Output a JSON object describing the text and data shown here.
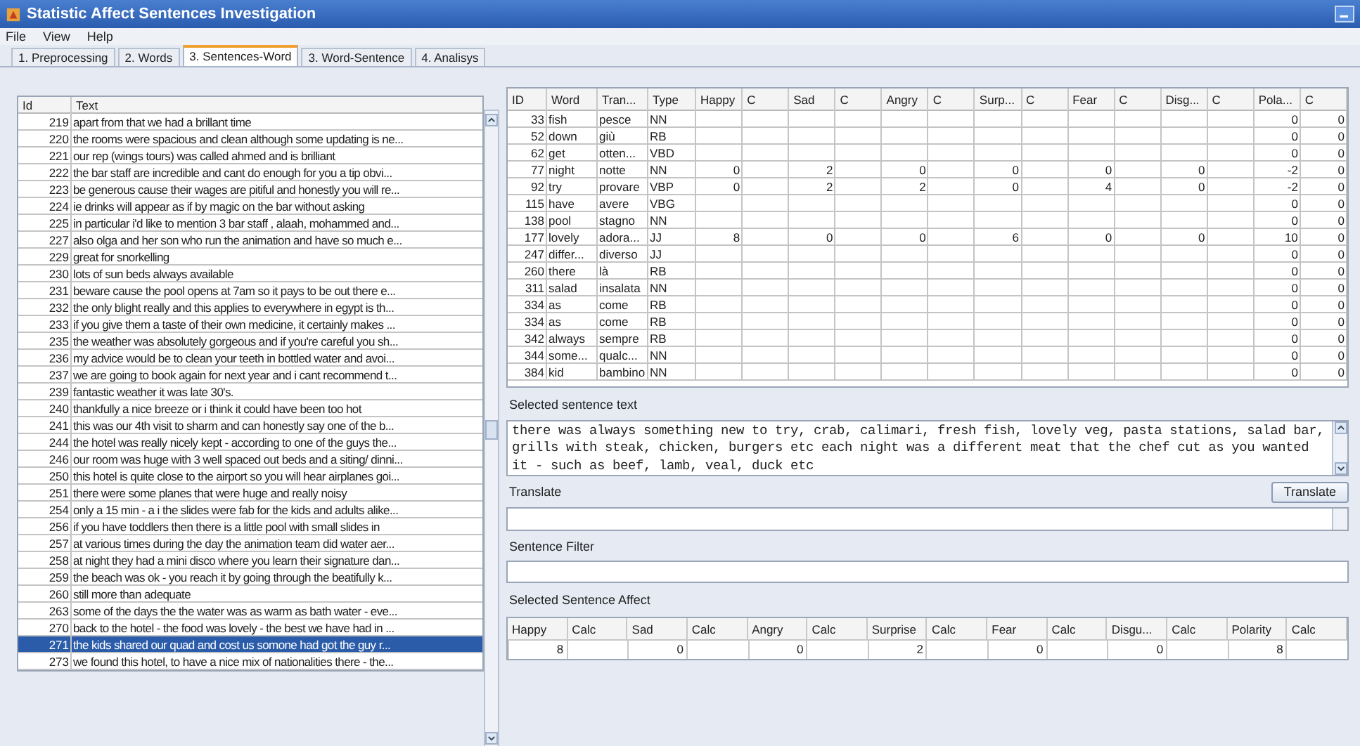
{
  "window": {
    "title": "Statistic Affect Sentences Investigation"
  },
  "menu": [
    "File",
    "View",
    "Help"
  ],
  "tabs": [
    {
      "label": "1. Preprocessing",
      "selected": false
    },
    {
      "label": "2. Words",
      "selected": false
    },
    {
      "label": "3. Sentences-Word",
      "selected": true
    },
    {
      "label": "3. Word-Sentence",
      "selected": false
    },
    {
      "label": "4. Analisys",
      "selected": false
    }
  ],
  "sentences": {
    "columns": [
      "Id",
      "Text"
    ],
    "rows": [
      {
        "id": "219",
        "text": "apart from that we had a brillant time",
        "selected": false
      },
      {
        "id": "220",
        "text": "the rooms were spacious and clean although some updating is ne...",
        "selected": false
      },
      {
        "id": "221",
        "text": "our rep (wings tours) was called ahmed and is brilliant",
        "selected": false
      },
      {
        "id": "222",
        "text": "the bar staff are incredible and cant do enough for you a tip obvi...",
        "selected": false
      },
      {
        "id": "223",
        "text": "be generous cause their wages are pitiful and honestly you will re...",
        "selected": false
      },
      {
        "id": "224",
        "text": "ie drinks will appear as if by magic on the bar without asking",
        "selected": false
      },
      {
        "id": "225",
        "text": "in particular i'd like to mention 3 bar staff , alaah, mohammed and...",
        "selected": false
      },
      {
        "id": "227",
        "text": "also olga and her son who run the animation and have so much e...",
        "selected": false
      },
      {
        "id": "229",
        "text": "great for snorkelling",
        "selected": false
      },
      {
        "id": "230",
        "text": "lots of sun beds always available",
        "selected": false
      },
      {
        "id": "231",
        "text": "beware cause the pool opens at 7am so it pays to be out there e...",
        "selected": false
      },
      {
        "id": "232",
        "text": "the only blight really and this applies to everywhere in egypt is th...",
        "selected": false
      },
      {
        "id": "233",
        "text": "if you give them a taste of their own medicine, it certainly makes ...",
        "selected": false
      },
      {
        "id": "235",
        "text": "the weather was absolutely gorgeous and if you're careful you sh...",
        "selected": false
      },
      {
        "id": "236",
        "text": "my advice would be to clean your teeth in bottled water and avoi...",
        "selected": false
      },
      {
        "id": "237",
        "text": "we are going to book again for next year and i cant recommend t...",
        "selected": false
      },
      {
        "id": "239",
        "text": "fantastic weather it was late 30's.",
        "selected": false
      },
      {
        "id": "240",
        "text": "thankfully a nice breeze or i think it could have been too hot",
        "selected": false
      },
      {
        "id": "241",
        "text": "this was our 4th visit to sharm and can honestly say one of the b...",
        "selected": false
      },
      {
        "id": "244",
        "text": "the hotel was really nicely kept - according to one of the guys the...",
        "selected": false
      },
      {
        "id": "246",
        "text": "our room was huge with 3 well spaced out beds and a siting/ dinni...",
        "selected": false
      },
      {
        "id": "250",
        "text": "this hotel is quite close to the airport so you will hear airplanes goi...",
        "selected": false
      },
      {
        "id": "251",
        "text": "there were some planes that were huge and really noisy",
        "selected": false
      },
      {
        "id": "254",
        "text": "only a 15 min - a i the slides were fab for the kids and adults alike...",
        "selected": false
      },
      {
        "id": "256",
        "text": "if you have toddlers then there is a little pool with small slides in",
        "selected": false
      },
      {
        "id": "257",
        "text": "at various times during the day the animation team did water aer...",
        "selected": false
      },
      {
        "id": "258",
        "text": "at night they had a mini disco where you learn their signature dan...",
        "selected": false
      },
      {
        "id": "259",
        "text": "the beach was ok - you reach it by going through the beatifully k...",
        "selected": false
      },
      {
        "id": "260",
        "text": "still more than adequate",
        "selected": false
      },
      {
        "id": "263",
        "text": "some of the days the the water was as warm as bath water - eve...",
        "selected": false
      },
      {
        "id": "270",
        "text": "back to the hotel - the food was lovely - the best we have had in ...",
        "selected": false
      },
      {
        "id": "271",
        "text": "the kids shared our quad and cost us somone had got the guy r...",
        "selected": true
      },
      {
        "id": "273",
        "text": "we found this hotel, to have a nice mix of nationalities there - the...",
        "selected": false
      }
    ]
  },
  "words": {
    "columns": [
      "ID",
      "Word",
      "Tran...",
      "Type",
      "Happy",
      "C",
      "Sad",
      "C",
      "Angry",
      "C",
      "Surp...",
      "C",
      "Fear",
      "C",
      "Disg...",
      "C",
      "Pola...",
      "C"
    ],
    "rows": [
      {
        "id": "33",
        "word": "fish",
        "translation": "pesce",
        "type": "NN",
        "polarity": "0",
        "polarity_c": "0"
      },
      {
        "id": "52",
        "word": "down",
        "translation": "giù",
        "type": "RB",
        "polarity": "0",
        "polarity_c": "0"
      },
      {
        "id": "62",
        "word": "get",
        "translation": "otten...",
        "type": "VBD",
        "polarity": "0",
        "polarity_c": "0"
      },
      {
        "id": "77",
        "word": "night",
        "translation": "notte",
        "type": "NN",
        "scores": [
          "0",
          "2",
          "0",
          "0",
          "0",
          "0"
        ],
        "polarity": "-2",
        "polarity_c": "0"
      },
      {
        "id": "92",
        "word": "try",
        "translation": "provare",
        "type": "VBP",
        "scores": [
          "0",
          "2",
          "2",
          "0",
          "4",
          "0"
        ],
        "polarity": "-2",
        "polarity_c": "0"
      },
      {
        "id": "115",
        "word": "have",
        "translation": "avere",
        "type": "VBG",
        "polarity": "0",
        "polarity_c": "0"
      },
      {
        "id": "138",
        "word": "pool",
        "translation": "stagno",
        "type": "NN",
        "polarity": "0",
        "polarity_c": "0"
      },
      {
        "id": "177",
        "word": "lovely",
        "translation": "adora...",
        "type": "JJ",
        "scores": [
          "8",
          "0",
          "0",
          "6",
          "0",
          "0"
        ],
        "polarity": "10",
        "polarity_c": "0"
      },
      {
        "id": "247",
        "word": "differ...",
        "translation": "diverso",
        "type": "JJ",
        "polarity": "0",
        "polarity_c": "0"
      },
      {
        "id": "260",
        "word": "there",
        "translation": "là",
        "type": "RB",
        "polarity": "0",
        "polarity_c": "0"
      },
      {
        "id": "311",
        "word": "salad",
        "translation": "insalata",
        "type": "NN",
        "polarity": "0",
        "polarity_c": "0"
      },
      {
        "id": "334",
        "word": "as",
        "translation": "come",
        "type": "RB",
        "polarity": "0",
        "polarity_c": "0"
      },
      {
        "id": "334",
        "word": "as",
        "translation": "come",
        "type": "RB",
        "polarity": "0",
        "polarity_c": "0"
      },
      {
        "id": "342",
        "word": "always",
        "translation": "sempre",
        "type": "RB",
        "polarity": "0",
        "polarity_c": "0"
      },
      {
        "id": "344",
        "word": "some...",
        "translation": "qualc...",
        "type": "NN",
        "polarity": "0",
        "polarity_c": "0"
      },
      {
        "id": "384",
        "word": "kid",
        "translation": "bambino",
        "type": "NN",
        "polarity": "0",
        "polarity_c": "0"
      }
    ]
  },
  "selected_sentence": {
    "label": "Selected sentence text",
    "value": "there was always something new to try, crab, calimari, fresh fish, lovely veg, pasta stations, salad bar, grills with steak, chicken, burgers etc each night was a different meat that the chef cut as you wanted it - such as beef, lamb, veal, duck etc"
  },
  "translate": {
    "label": "Translate",
    "button": "Translate"
  },
  "sentence_filter": {
    "label": "Sentence Filter"
  },
  "affect": {
    "label": "Selected Sentence Affect",
    "columns": [
      {
        "label": "Happy",
        "value": "8",
        "calc_label": "Calc"
      },
      {
        "label": "Sad",
        "value": "0",
        "calc_label": "Calc"
      },
      {
        "label": "Angry",
        "value": "0",
        "calc_label": "Calc"
      },
      {
        "label": "Surprise",
        "value": "2",
        "calc_label": "Calc"
      },
      {
        "label": "Fear",
        "value": "0",
        "calc_label": "Calc"
      },
      {
        "label": "Disgu...",
        "value": "0",
        "calc_label": "Calc"
      },
      {
        "label": "Polarity",
        "value": "8",
        "calc_label": "Calc"
      }
    ]
  }
}
